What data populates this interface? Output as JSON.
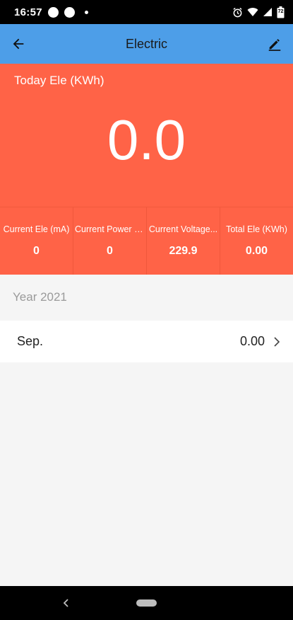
{
  "status_bar": {
    "time": "16:57",
    "battery": "72"
  },
  "app_bar": {
    "title": "Electric",
    "back_icon": "arrow-left-icon",
    "edit_icon": "pencil-icon"
  },
  "hero": {
    "label": "Today Ele (KWh)",
    "value": "0.0"
  },
  "stats": [
    {
      "label": "Current Ele (mA)",
      "value": "0"
    },
    {
      "label": "Current Power (W)",
      "value": "0"
    },
    {
      "label": "Current Voltage...",
      "value": "229.9"
    },
    {
      "label": "Total Ele (KWh)",
      "value": "0.00"
    }
  ],
  "year_section": {
    "label": "Year 2021",
    "months": [
      {
        "name": "Sep.",
        "value": "0.00"
      }
    ]
  },
  "colors": {
    "app_bar": "#4d9ee8",
    "accent": "#ff6347",
    "background": "#f5f5f5"
  }
}
